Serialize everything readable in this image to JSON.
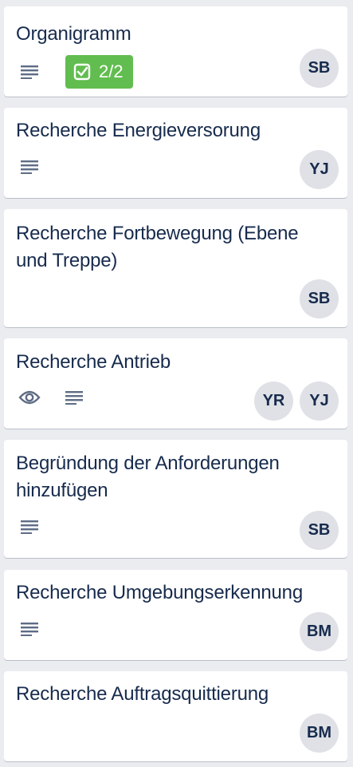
{
  "cards": [
    {
      "title": "Organigramm",
      "badges": [
        "description-icon"
      ],
      "checklist": "2/2",
      "members": [
        "SB"
      ]
    },
    {
      "title": "Recherche Energieversorung",
      "badges": [
        "description-icon"
      ],
      "members": [
        "YJ"
      ]
    },
    {
      "title": "Recherche Fortbewegung (Ebene und Treppe)",
      "badges": [],
      "members": [
        "SB"
      ]
    },
    {
      "title": "Recherche Antrieb",
      "badges": [
        "watch-icon",
        "description-icon"
      ],
      "members": [
        "YR",
        "YJ"
      ]
    },
    {
      "title": "Begründung der Anforderungen hinzufügen",
      "badges": [
        "description-icon"
      ],
      "members": [
        "SB"
      ]
    },
    {
      "title": "Recherche Umgebungserkennung",
      "badges": [
        "description-icon"
      ],
      "members": [
        "BM"
      ]
    },
    {
      "title": "Recherche Auftragsquittierung",
      "badges": [],
      "members": [
        "BM"
      ]
    }
  ],
  "colors": {
    "board_bg": "#ebecf0",
    "card_bg": "#ffffff",
    "checklist_complete": "#61bd4f",
    "avatar_bg": "#dfe1e6",
    "text": "#172b4d",
    "icon": "#5e6c84"
  }
}
